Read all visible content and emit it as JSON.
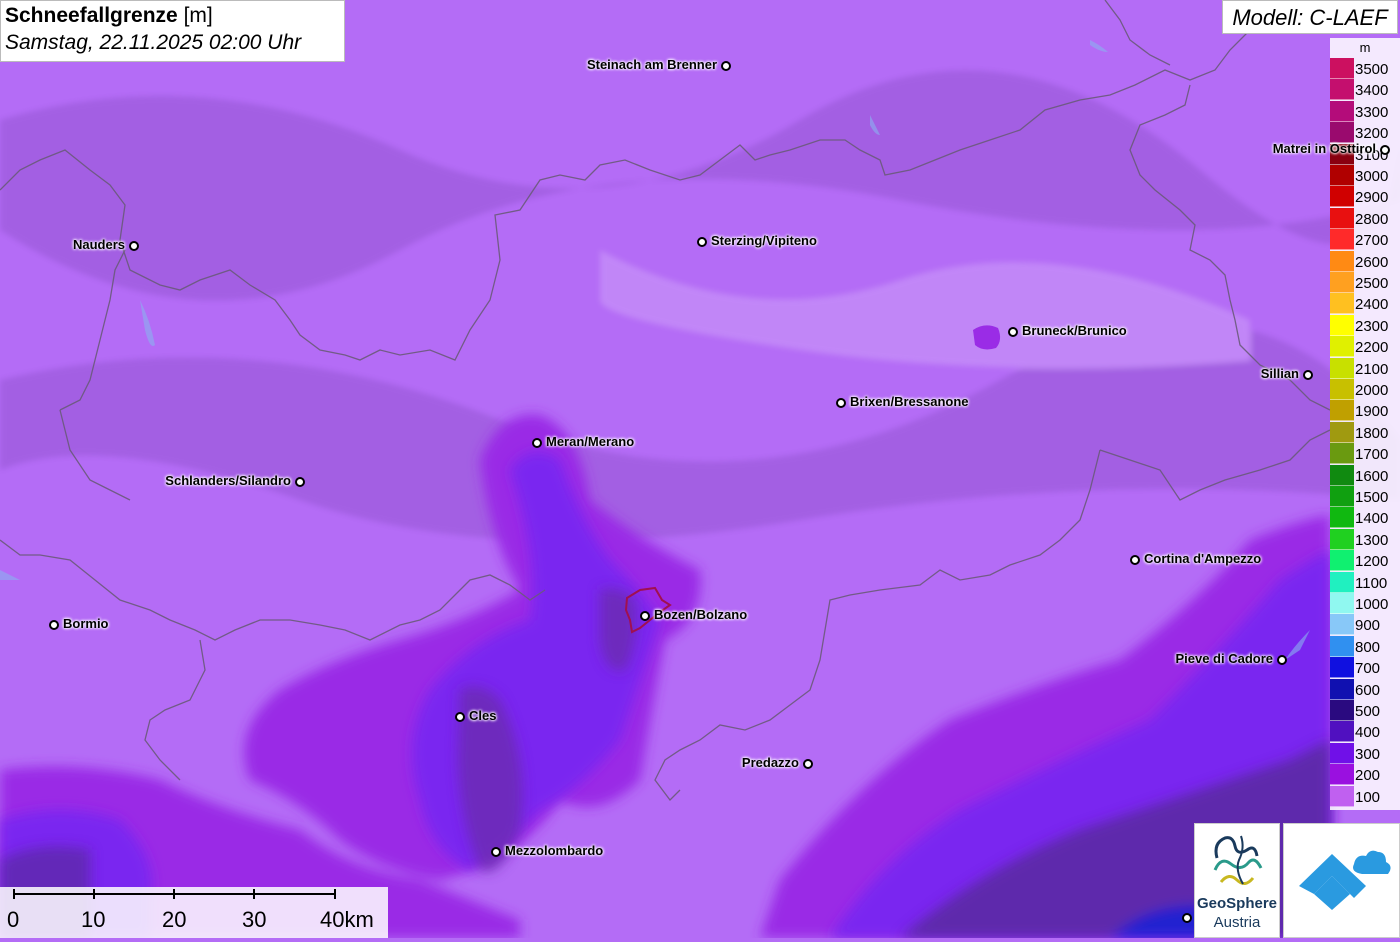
{
  "title": {
    "main_bold": "Schneefallgrenze",
    "main_unit": "[m]",
    "subtitle": "Samstag, 22.11.2025 02:00 Uhr"
  },
  "model": "Modell: C-LAEF",
  "legend": {
    "unit": "m",
    "items": [
      {
        "label": "3500",
        "color": "#cc1060"
      },
      {
        "label": "3400",
        "color": "#c40f6e"
      },
      {
        "label": "3300",
        "color": "#b40c7a"
      },
      {
        "label": "3200",
        "color": "#9a0a6e"
      },
      {
        "label": "3100",
        "color": "#8a0010"
      },
      {
        "label": "3000",
        "color": "#b00000"
      },
      {
        "label": "2900",
        "color": "#d00000"
      },
      {
        "label": "2800",
        "color": "#e81010"
      },
      {
        "label": "2700",
        "color": "#ff2a2a"
      },
      {
        "label": "2600",
        "color": "#ff8a14"
      },
      {
        "label": "2500",
        "color": "#ffa020"
      },
      {
        "label": "2400",
        "color": "#ffc020"
      },
      {
        "label": "2300",
        "color": "#ffff00"
      },
      {
        "label": "2200",
        "color": "#e0f000"
      },
      {
        "label": "2100",
        "color": "#c8e000"
      },
      {
        "label": "2000",
        "color": "#c8c000"
      },
      {
        "label": "1900",
        "color": "#c0a000"
      },
      {
        "label": "1800",
        "color": "#a09a10"
      },
      {
        "label": "1700",
        "color": "#6a9a10"
      },
      {
        "label": "1600",
        "color": "#108a10"
      },
      {
        "label": "1500",
        "color": "#10a010"
      },
      {
        "label": "1400",
        "color": "#10b810"
      },
      {
        "label": "1300",
        "color": "#20d020"
      },
      {
        "label": "1200",
        "color": "#10f070"
      },
      {
        "label": "1100",
        "color": "#20f0c0"
      },
      {
        "label": "1000",
        "color": "#90f8f0"
      },
      {
        "label": "900",
        "color": "#88c8f8"
      },
      {
        "label": "800",
        "color": "#3090f0"
      },
      {
        "label": "700",
        "color": "#1010e0"
      },
      {
        "label": "600",
        "color": "#1010b0"
      },
      {
        "label": "500",
        "color": "#2a0a80"
      },
      {
        "label": "400",
        "color": "#5010c0"
      },
      {
        "label": "300",
        "color": "#7010e8"
      },
      {
        "label": "200",
        "color": "#9a10e0"
      },
      {
        "label": "100",
        "color": "#c060f0"
      }
    ]
  },
  "cities": [
    {
      "name": "Steinach am Brenner",
      "side": "left"
    },
    {
      "name": "Matrei in Osttirol",
      "side": "left"
    },
    {
      "name": "Nauders",
      "side": "left"
    },
    {
      "name": "Sterzing/Vipiteno",
      "side": "right"
    },
    {
      "name": "Bruneck/Brunico",
      "side": "right"
    },
    {
      "name": "Sillian",
      "side": "left"
    },
    {
      "name": "Brixen/Bressanone",
      "side": "right"
    },
    {
      "name": "Meran/Merano",
      "side": "right"
    },
    {
      "name": "Schlanders/Silandro",
      "side": "left"
    },
    {
      "name": "Cortina d'Ampezzo",
      "side": "right"
    },
    {
      "name": "Bormio",
      "side": "right"
    },
    {
      "name": "Bozen/Bolzano",
      "side": "right"
    },
    {
      "name": "Pieve di Cadore",
      "side": "left"
    },
    {
      "name": "Cles",
      "side": "right"
    },
    {
      "name": "Predazzo",
      "side": "left"
    },
    {
      "name": "Mezzolombardo",
      "side": "right"
    },
    {
      "name": "",
      "side": "none"
    }
  ],
  "scale_bar": {
    "labels": [
      "0",
      "10",
      "20",
      "30",
      "40km"
    ]
  },
  "logo": {
    "name": "GeoSphere",
    "country": "Austria"
  },
  "colors": {
    "background_snowline": "#b46cf6"
  }
}
